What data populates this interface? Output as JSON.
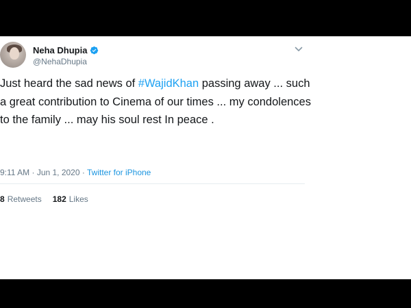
{
  "tweet": {
    "display_name": "Neha Dhupia",
    "handle": "@NehaDhupia",
    "verified": true,
    "text_before": "Just heard the sad news of ",
    "hashtag": "#WajidKhan",
    "text_after": " passing away ... such a great contribution to Cinema of our times ... my condolences to the family ... may his soul rest In peace .",
    "time": "9:11 AM",
    "separator": " · ",
    "date": "Jun 1, 2020",
    "source": "Twitter for iPhone"
  },
  "stats": {
    "retweets_count": "8",
    "retweets_label": "Retweets",
    "likes_count": "182",
    "likes_label": "Likes"
  },
  "colors": {
    "link": "#1da1f2",
    "muted": "#657786",
    "text": "#14171a"
  },
  "icons": {
    "verified": "verified-badge-icon",
    "menu": "chevron-down-icon"
  }
}
